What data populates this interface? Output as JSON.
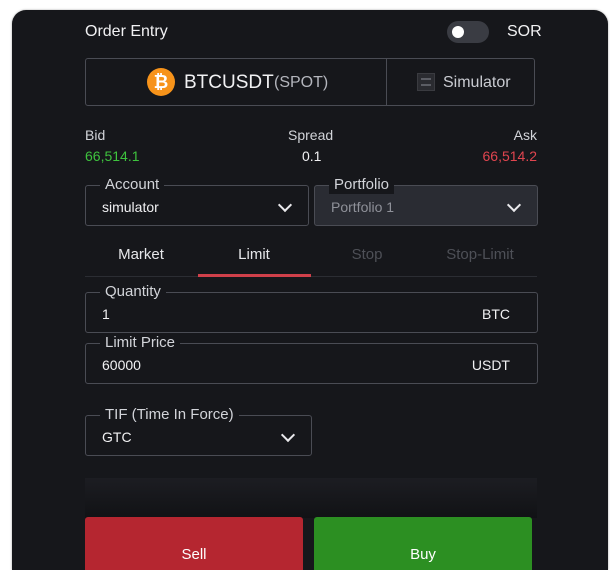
{
  "header": {
    "title": "Order Entry",
    "sor_label": "SOR",
    "sor_enabled": false
  },
  "symbol": {
    "name": "BTCUSDT",
    "type": "(SPOT)",
    "icon": "bitcoin-icon",
    "icon_glyph": "₿",
    "icon_color": "#f7931a",
    "venue_icon": "simulator-icon",
    "venue": "Simulator"
  },
  "quote": {
    "bid_label": "Bid",
    "bid_value": "66,514.1",
    "bid_color": "#3ec33e",
    "spread_label": "Spread",
    "spread_value": "0.1",
    "ask_label": "Ask",
    "ask_value": "66,514.2",
    "ask_color": "#e0454f"
  },
  "account": {
    "label": "Account",
    "value": "simulator"
  },
  "portfolio": {
    "label": "Portfolio",
    "value": "Portfolio 1"
  },
  "tabs": [
    {
      "label": "Market",
      "active": false,
      "enabled": true
    },
    {
      "label": "Limit",
      "active": true,
      "enabled": true
    },
    {
      "label": "Stop",
      "active": false,
      "enabled": false
    },
    {
      "label": "Stop-Limit",
      "active": false,
      "enabled": false
    }
  ],
  "quantity": {
    "label": "Quantity",
    "value": "1",
    "unit": "BTC"
  },
  "limit_price": {
    "label": "Limit Price",
    "value": "60000",
    "unit": "USDT"
  },
  "tif": {
    "label": "TIF (Time In Force)",
    "value": "GTC"
  },
  "actions": {
    "sell_label": "Sell",
    "sell_color": "#b52630",
    "buy_label": "Buy",
    "buy_color": "#2c8f22"
  },
  "colors": {
    "panel_bg": "#16171b",
    "accent": "#d0404a"
  }
}
